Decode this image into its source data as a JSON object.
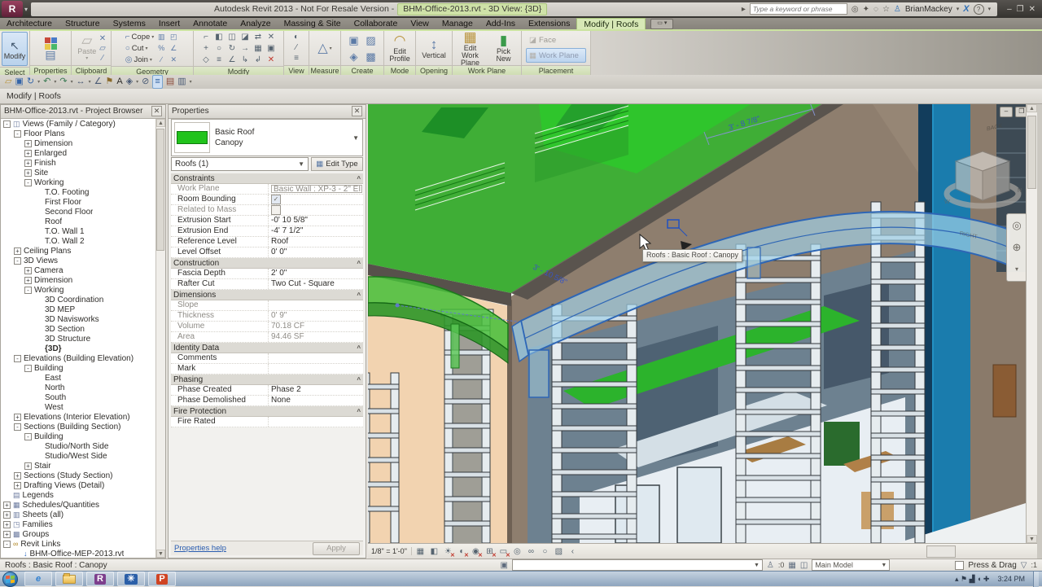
{
  "window": {
    "app_title": "Autodesk Revit 2013 - Not For Resale Version -",
    "doc_title": "BHM-Office-2013.rvt - 3D View: {3D}",
    "search_placeholder": "Type a keyword or phrase",
    "user_name": "BrianMackey",
    "exchange_label": "X",
    "help_label": "?"
  },
  "tabs": {
    "items": [
      "Architecture",
      "Structure",
      "Systems",
      "Insert",
      "Annotate",
      "Analyze",
      "Massing & Site",
      "Collaborate",
      "View",
      "Manage",
      "Add-Ins",
      "Extensions"
    ],
    "active": "Modify | Roofs"
  },
  "ribbon": {
    "select_label": "Select",
    "modify_button": "Modify",
    "properties_label": "Properties",
    "clipboard_label": "Clipboard",
    "paste_label": "Paste",
    "geometry_label": "Geometry",
    "cope": "Cope",
    "cut": "Cut",
    "join": "Join",
    "modify_label": "Modify",
    "view_label": "View",
    "measure_label": "Measure",
    "create_label": "Create",
    "mode_label": "Mode",
    "edit_profile_1": "Edit",
    "edit_profile_2": "Profile",
    "opening_label": "Opening",
    "vertical": "Vertical",
    "workplane_label": "Work Plane",
    "edit_work_plane_1": "Edit",
    "edit_work_plane_2": "Work Plane",
    "pick_new_1": "Pick",
    "pick_new_2": "New",
    "placement_label": "Placement",
    "face": "Face",
    "work_plane": "Work Plane"
  },
  "modify_bar": "Modify | Roofs",
  "project_browser": {
    "title": "BHM-Office-2013.rvt - Project Browser",
    "items": [
      {
        "l": "Views (Family / Category)",
        "d": 0,
        "e": "-",
        "i": "views"
      },
      {
        "l": "Floor Plans",
        "d": 1,
        "e": "-"
      },
      {
        "l": "Dimension",
        "d": 2,
        "e": "+"
      },
      {
        "l": "Enlarged",
        "d": 2,
        "e": "+"
      },
      {
        "l": "Finish",
        "d": 2,
        "e": "+"
      },
      {
        "l": "Site",
        "d": 2,
        "e": "+"
      },
      {
        "l": "Working",
        "d": 2,
        "e": "-"
      },
      {
        "l": "T.O. Footing",
        "d": 3,
        "e": ""
      },
      {
        "l": "First Floor",
        "d": 3,
        "e": ""
      },
      {
        "l": "Second Floor",
        "d": 3,
        "e": ""
      },
      {
        "l": "Roof",
        "d": 3,
        "e": ""
      },
      {
        "l": "T.O. Wall 1",
        "d": 3,
        "e": ""
      },
      {
        "l": "T.O. Wall 2",
        "d": 3,
        "e": ""
      },
      {
        "l": "Ceiling Plans",
        "d": 1,
        "e": "+"
      },
      {
        "l": "3D Views",
        "d": 1,
        "e": "-"
      },
      {
        "l": "Camera",
        "d": 2,
        "e": "+"
      },
      {
        "l": "Dimension",
        "d": 2,
        "e": "+"
      },
      {
        "l": "Working",
        "d": 2,
        "e": "-"
      },
      {
        "l": "3D Coordination",
        "d": 3,
        "e": ""
      },
      {
        "l": "3D MEP",
        "d": 3,
        "e": ""
      },
      {
        "l": "3D Navisworks",
        "d": 3,
        "e": ""
      },
      {
        "l": "3D Section",
        "d": 3,
        "e": ""
      },
      {
        "l": "3D Structure",
        "d": 3,
        "e": ""
      },
      {
        "l": "{3D}",
        "d": 3,
        "e": "",
        "b": true
      },
      {
        "l": "Elevations (Building Elevation)",
        "d": 1,
        "e": "-"
      },
      {
        "l": "Building",
        "d": 2,
        "e": "-"
      },
      {
        "l": "East",
        "d": 3,
        "e": ""
      },
      {
        "l": "North",
        "d": 3,
        "e": ""
      },
      {
        "l": "South",
        "d": 3,
        "e": ""
      },
      {
        "l": "West",
        "d": 3,
        "e": ""
      },
      {
        "l": "Elevations (Interior Elevation)",
        "d": 1,
        "e": "+"
      },
      {
        "l": "Sections (Building Section)",
        "d": 1,
        "e": "-"
      },
      {
        "l": "Building",
        "d": 2,
        "e": "-"
      },
      {
        "l": "Studio/North Side",
        "d": 3,
        "e": ""
      },
      {
        "l": "Studio/West Side",
        "d": 3,
        "e": ""
      },
      {
        "l": "Stair",
        "d": 2,
        "e": "+"
      },
      {
        "l": "Sections (Study Section)",
        "d": 1,
        "e": "+"
      },
      {
        "l": "Drafting Views (Detail)",
        "d": 1,
        "e": "+"
      },
      {
        "l": "Legends",
        "d": 0,
        "e": "",
        "i": "legends"
      },
      {
        "l": "Schedules/Quantities",
        "d": 0,
        "e": "+",
        "i": "schedules"
      },
      {
        "l": "Sheets (all)",
        "d": 0,
        "e": "+",
        "i": "sheets"
      },
      {
        "l": "Families",
        "d": 0,
        "e": "+",
        "i": "families"
      },
      {
        "l": "Groups",
        "d": 0,
        "e": "+",
        "i": "groups"
      },
      {
        "l": "Revit Links",
        "d": 0,
        "e": "-",
        "i": "links"
      },
      {
        "l": "BHM-Office-MEP-2013.rvt",
        "d": 1,
        "e": "",
        "i": "file"
      }
    ]
  },
  "properties": {
    "title": "Properties",
    "type_primary": "Basic Roof",
    "type_secondary": "Canopy",
    "filter": "Roofs (1)",
    "edit_type": "Edit Type",
    "rows": [
      {
        "t": "h",
        "l": "Constraints"
      },
      {
        "t": "r",
        "l": "Work Plane",
        "v": "Basic Wall : XP-3 - 2\" EIFS - 5/...",
        "box": true,
        "gray": true
      },
      {
        "t": "r",
        "l": "Room Bounding",
        "v": "",
        "cb": "on"
      },
      {
        "t": "r",
        "l": "Related to Mass",
        "v": "",
        "cb": "off",
        "gray": true
      },
      {
        "t": "r",
        "l": "Extrusion Start",
        "v": "-0'  10 5/8\""
      },
      {
        "t": "r",
        "l": "Extrusion End",
        "v": "-4'  7 1/2\""
      },
      {
        "t": "r",
        "l": "Reference Level",
        "v": "Roof"
      },
      {
        "t": "r",
        "l": "Level Offset",
        "v": "0'  0\""
      },
      {
        "t": "h",
        "l": "Construction"
      },
      {
        "t": "r",
        "l": "Fascia Depth",
        "v": "2'  0\""
      },
      {
        "t": "r",
        "l": "Rafter Cut",
        "v": "Two Cut - Square"
      },
      {
        "t": "h",
        "l": "Dimensions"
      },
      {
        "t": "r",
        "l": "Slope",
        "v": "",
        "gray": true
      },
      {
        "t": "r",
        "l": "Thickness",
        "v": "0'  9\"",
        "gray": true
      },
      {
        "t": "r",
        "l": "Volume",
        "v": "70.18 CF",
        "gray": true
      },
      {
        "t": "r",
        "l": "Area",
        "v": "94.46 SF",
        "gray": true
      },
      {
        "t": "h",
        "l": "Identity Data"
      },
      {
        "t": "r",
        "l": "Comments",
        "v": ""
      },
      {
        "t": "r",
        "l": "Mark",
        "v": ""
      },
      {
        "t": "h",
        "l": "Phasing"
      },
      {
        "t": "r",
        "l": "Phase Created",
        "v": "Phase 2"
      },
      {
        "t": "r",
        "l": "Phase Demolished",
        "v": "None"
      },
      {
        "t": "h",
        "l": "Fire Protection"
      },
      {
        "t": "r",
        "l": "Fire Rated",
        "v": ""
      }
    ],
    "help_link": "Properties help",
    "apply": "Apply"
  },
  "viewport": {
    "tooltip": "Roofs : Basic Roof : Canopy",
    "dim_roof": "3' - 8 7/8\"",
    "dim_canopy": "3' - 10 5/8\"",
    "viewcube": {
      "left_face": "RIGHT",
      "right_face": "BACK"
    },
    "scale": "1/8\" = 1'-0\""
  },
  "status_bar": {
    "message": "Roofs : Basic Roof : Canopy",
    "editable_count": ":0",
    "design_option": "Main Model",
    "press_drag": "Press & Drag",
    "filter_count": ":1"
  },
  "colors": {
    "contextual_tab": "#d7e8b6",
    "selection_blue": "#2e66b5",
    "roof_green": "#3fae36",
    "phase_green_canopy": "#46c33a",
    "wall_peach": "#f2d3b0",
    "wall_taupe": "#8e7e6e",
    "column_blue": "#1a7cad",
    "type_swatch_green": "#21c31c"
  },
  "icons": {
    "qat": [
      {
        "n": "open-icon",
        "g": "▱",
        "c": "#b8923a"
      },
      {
        "n": "save-icon",
        "g": "▣",
        "c": "#3565a8"
      },
      {
        "n": "sync-icon",
        "g": "↻",
        "c": "#3565a8",
        "drop": true
      },
      {
        "n": "undo-icon",
        "g": "↶",
        "c": "#3a7a52",
        "drop": true
      },
      {
        "n": "redo-icon",
        "g": "↷",
        "c": "#3a7a52",
        "drop": true
      },
      {
        "n": "measure-icon",
        "g": "↔",
        "c": "#4a5a74",
        "drop": true
      },
      {
        "n": "aligned-dimension-icon",
        "g": "∠",
        "c": "#4a5a74"
      },
      {
        "n": "tag-icon",
        "g": "⚑",
        "c": "#8a6a2a"
      },
      {
        "n": "text-icon",
        "g": "A",
        "c": "#2e2c29"
      },
      {
        "n": "default-3d-view-icon",
        "g": "◈",
        "c": "#4a5a74",
        "drop": true
      },
      {
        "n": "section-icon",
        "g": "⊘",
        "c": "#4a5a74"
      },
      {
        "n": "thin-lines-icon",
        "g": "≡",
        "c": "#2f5f9e",
        "active": true
      },
      {
        "n": "close-hidden-windows-icon",
        "g": "▤",
        "c": "#8a4a3a"
      },
      {
        "n": "switch-windows-icon",
        "g": "▥",
        "c": "#4a5a74",
        "drop": true
      }
    ],
    "view_bar": [
      {
        "n": "detail-level-icon",
        "g": "▦"
      },
      {
        "n": "visual-style-icon",
        "g": "◧"
      },
      {
        "n": "sun-path-icon",
        "g": "☀",
        "off": true
      },
      {
        "n": "shadows-icon",
        "g": "◐",
        "off": true
      },
      {
        "n": "rendering-dialog-icon",
        "g": "◉",
        "off": true
      },
      {
        "n": "crop-view-icon",
        "g": "⊞",
        "off": true
      },
      {
        "n": "crop-region-icon",
        "g": "▭",
        "off": true
      },
      {
        "n": "lock-3d-view-icon",
        "g": "◎"
      },
      {
        "n": "temporary-hide-isolate-icon",
        "g": "∞"
      },
      {
        "n": "reveal-hidden-icon",
        "g": "○"
      },
      {
        "n": "worksharing-display-icon",
        "g": "▧"
      },
      {
        "n": "expand-view-bar-icon",
        "g": "‹"
      }
    ],
    "modify_panel": [
      {
        "n": "align-icon",
        "g": "⌐"
      },
      {
        "n": "offset-icon",
        "g": "◧"
      },
      {
        "n": "mirror-pick-axis-icon",
        "g": "◫"
      },
      {
        "n": "mirror-draw-axis-icon",
        "g": "◪"
      },
      {
        "n": "split-element-icon",
        "g": "⇄"
      },
      {
        "n": "split-with-gap-icon",
        "g": "✕"
      },
      {
        "n": "move-icon",
        "g": "+"
      },
      {
        "n": "copy-icon",
        "g": "○"
      },
      {
        "n": "rotate-icon",
        "g": "↻"
      },
      {
        "n": "array-icon",
        "g": "→"
      },
      {
        "n": "scale-icon",
        "g": "▦"
      },
      {
        "n": "pin-icon",
        "g": "▣"
      },
      {
        "n": "unpin-icon",
        "g": "◇"
      },
      {
        "n": "trim-extend-icon",
        "g": "≡"
      },
      {
        "n": "trim-corner-icon",
        "g": "∠"
      },
      {
        "n": "extend-single-icon",
        "g": "↳"
      },
      {
        "n": "extend-multiple-icon",
        "g": "↲"
      },
      {
        "n": "delete-icon",
        "g": "✕",
        "red": true
      }
    ],
    "geometry_extra": [
      {
        "n": "beam-joins-icon",
        "g": "▥"
      },
      {
        "n": "wall-joins-icon",
        "g": "◰"
      },
      {
        "n": "paint-icon",
        "g": "%"
      },
      {
        "n": "demolish-icon",
        "g": "∠"
      },
      {
        "n": "remove-paint-icon",
        "g": "∕"
      },
      {
        "n": "split-face-icon",
        "g": "✕"
      }
    ],
    "create_panel": [
      {
        "n": "create-similar-icon",
        "g": "▣"
      },
      {
        "n": "create-group-icon",
        "g": "▨"
      },
      {
        "n": "create-assembly-icon",
        "g": "◈"
      },
      {
        "n": "create-parts-icon",
        "g": "▩"
      }
    ],
    "view_panel": [
      {
        "n": "visibility-graphics-icon",
        "g": "◐"
      },
      {
        "n": "override-graphics-icon",
        "g": "∕"
      },
      {
        "n": "thin-lines-view-icon",
        "g": "≡"
      }
    ],
    "clipboard_extra": [
      {
        "n": "match-type-icon",
        "g": "✕"
      },
      {
        "n": "copy-clipboard-icon",
        "g": "▱"
      },
      {
        "n": "cut-clipboard-icon",
        "g": "∕"
      }
    ]
  },
  "taskbar": {
    "buttons": [
      {
        "n": "internet-explorer-icon",
        "letter": "e",
        "color": "#2f7fd0",
        "bg": "transparent",
        "italic": true
      },
      {
        "n": "windows-explorer-icon",
        "folder": true
      },
      {
        "n": "revit-app-icon",
        "letter": "R",
        "color": "#ffffff",
        "bg": "#7d3f8d"
      },
      {
        "n": "revit-mep-app-icon",
        "letter": "✳",
        "color": "#ffffff",
        "bg": "#2b5fa8"
      },
      {
        "n": "powerpoint-app-icon",
        "letter": "P",
        "color": "#ffffff",
        "bg": "#d04423"
      }
    ],
    "tray": [
      {
        "n": "show-hidden-icons-icon",
        "g": "▴"
      },
      {
        "n": "action-center-icon",
        "g": "⚑"
      },
      {
        "n": "network-icon",
        "g": "▟"
      },
      {
        "n": "volume-icon",
        "g": "◖"
      },
      {
        "n": "safely-remove-icon",
        "g": "✚"
      }
    ],
    "time": "3:24 PM"
  }
}
